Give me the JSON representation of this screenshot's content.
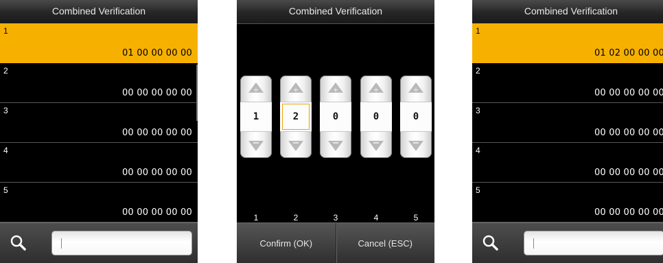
{
  "screens": [
    {
      "title": "Combined Verification",
      "rows": [
        {
          "index": "1",
          "value": "01 00 00 00 00"
        },
        {
          "index": "2",
          "value": "00 00 00 00 00"
        },
        {
          "index": "3",
          "value": "00 00 00 00 00"
        },
        {
          "index": "4",
          "value": "00 00 00 00 00"
        },
        {
          "index": "5",
          "value": "00 00 00 00 00"
        }
      ],
      "selected_row": 1,
      "search": {
        "value": "|",
        "icon": "search-icon"
      }
    },
    {
      "title": "Combined Verification",
      "spinners": [
        {
          "value": "1",
          "label": "1"
        },
        {
          "value": "2",
          "label": "2"
        },
        {
          "value": "0",
          "label": "3"
        },
        {
          "value": "0",
          "label": "4"
        },
        {
          "value": "0",
          "label": "5"
        }
      ],
      "active_spinner": 2,
      "confirm_label": "Confirm (OK)",
      "cancel_label": "Cancel (ESC)"
    },
    {
      "title": "Combined Verification",
      "rows": [
        {
          "index": "1",
          "value": "01 02 00 00 00"
        },
        {
          "index": "2",
          "value": "00 00 00 00 00"
        },
        {
          "index": "3",
          "value": "00 00 00 00 00"
        },
        {
          "index": "4",
          "value": "00 00 00 00 00"
        },
        {
          "index": "5",
          "value": "00 00 00 00 00"
        }
      ],
      "selected_row": 1,
      "search": {
        "value": "|",
        "icon": "search-icon"
      }
    }
  ],
  "colors": {
    "highlight": "#f6b000",
    "background": "#000000"
  }
}
